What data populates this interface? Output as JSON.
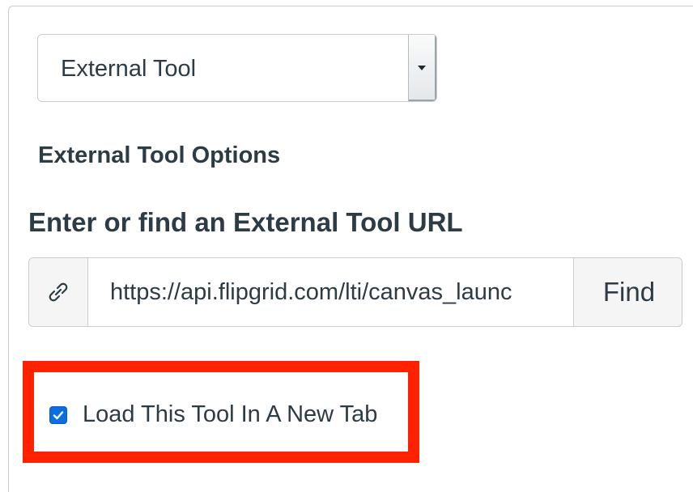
{
  "item_type_select": {
    "selected": "External Tool"
  },
  "external_tool": {
    "options_heading": "External Tool Options",
    "url_label": "Enter or find an External Tool URL",
    "url_value": "https://api.flipgrid.com/lti/canvas_launc",
    "find_label": "Find",
    "url_icon": "link-icon",
    "new_tab_checkbox": {
      "label": "Load This Tool In A New Tab",
      "checked": true
    }
  },
  "colors": {
    "highlight_border": "#ff2200",
    "checkbox_fill": "#0b6fde",
    "text": "#2d3b45"
  }
}
